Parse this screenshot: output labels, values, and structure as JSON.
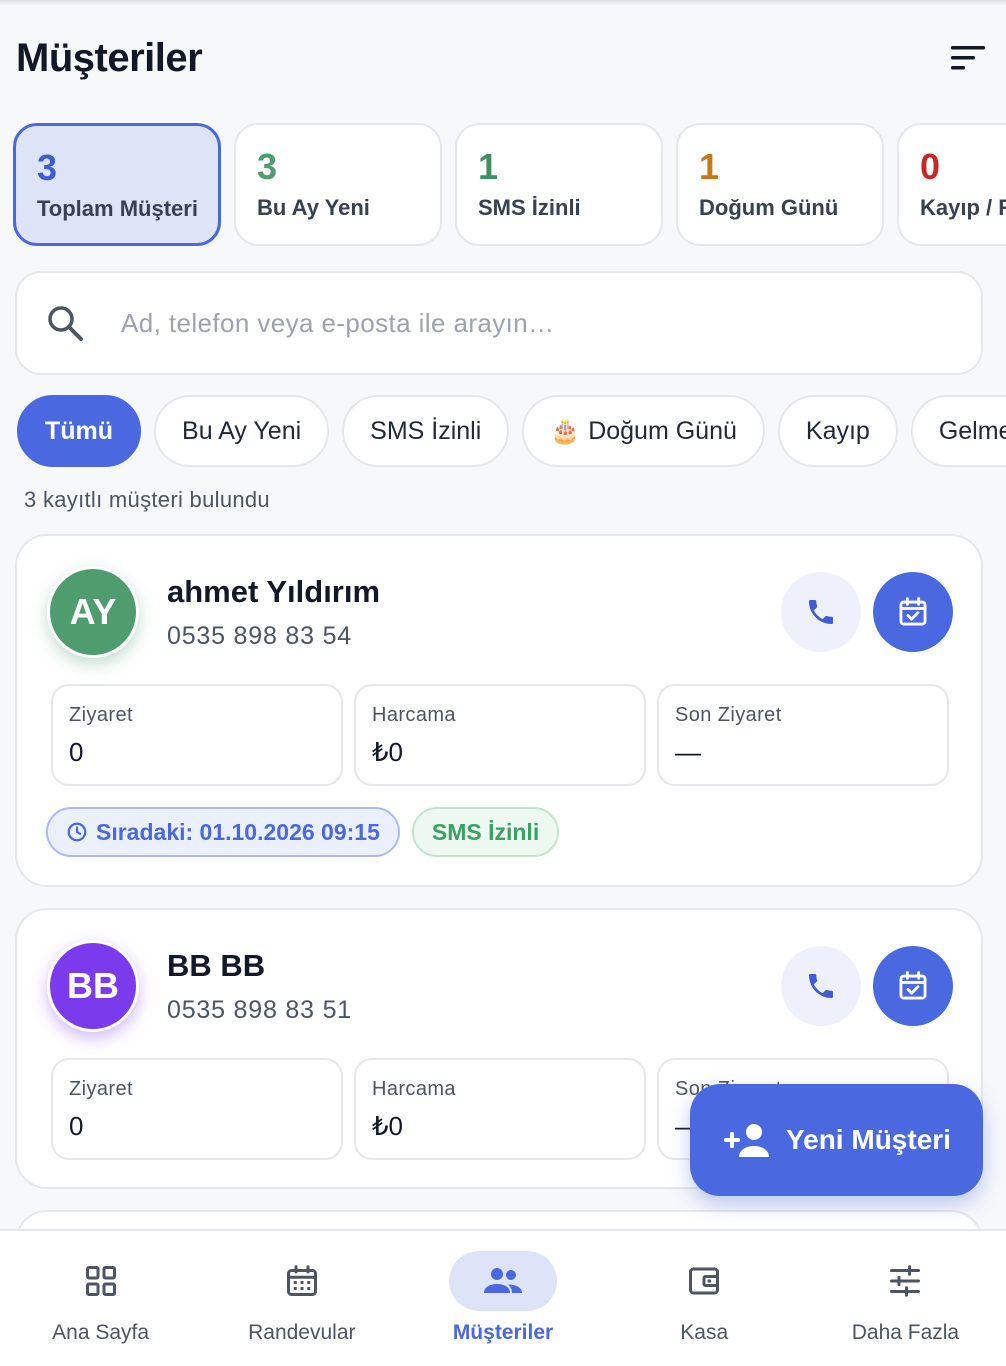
{
  "header": {
    "title": "Müşteriler",
    "sort_icon": "sort-lines-icon"
  },
  "stats": [
    {
      "value": "3",
      "label": "Toplam Müşteri",
      "color": "#3f5bd6",
      "active": true
    },
    {
      "value": "3",
      "label": "Bu Ay Yeni",
      "color": "#4f9d6f",
      "active": false
    },
    {
      "value": "1",
      "label": "SMS İzinli",
      "color": "#3e8f64",
      "active": false
    },
    {
      "value": "1",
      "label": "Doğum Günü",
      "color": "#c4781a",
      "active": false
    },
    {
      "value": "0",
      "label": "Kayıp / R",
      "color": "#c62828",
      "active": false
    }
  ],
  "search": {
    "placeholder": "Ad, telefon veya e-posta ile arayın…",
    "value": ""
  },
  "filters": [
    {
      "label": "Tümü",
      "active": true,
      "icon": ""
    },
    {
      "label": "Bu Ay Yeni",
      "active": false,
      "icon": ""
    },
    {
      "label": "SMS İzinli",
      "active": false,
      "icon": ""
    },
    {
      "label": "Doğum Günü",
      "active": false,
      "icon": "🎂"
    },
    {
      "label": "Kayıp",
      "active": false,
      "icon": ""
    },
    {
      "label": "Gelmem",
      "active": false,
      "icon": ""
    }
  ],
  "result_count": "3 kayıtlı müşteri bulundu",
  "metric_labels": {
    "visits": "Ziyaret",
    "spend": "Harcama",
    "last": "Son Ziyaret"
  },
  "customers": [
    {
      "initials": "AY",
      "name": "ahmet Yıldırım",
      "phone": "0535 898 83 54",
      "avatar_color": "#4f9d6f",
      "visits": "0",
      "spend": "₺0",
      "last_visit": "—",
      "next_badge": "Sıradaki: 01.10.2026 09:15",
      "sms_badge": "SMS İzinli"
    },
    {
      "initials": "BB",
      "name": "BB BB",
      "phone": "0535 898 83 51",
      "avatar_color": "#7c3aed",
      "visits": "0",
      "spend": "₺0",
      "last_visit": "—"
    }
  ],
  "fab": {
    "label": "Yeni Müşteri"
  },
  "nav": [
    {
      "label": "Ana Sayfa",
      "icon": "grid-icon",
      "active": false
    },
    {
      "label": "Randevular",
      "icon": "calendar-icon",
      "active": false
    },
    {
      "label": "Müşteriler",
      "icon": "people-icon",
      "active": true
    },
    {
      "label": "Kasa",
      "icon": "wallet-icon",
      "active": false
    },
    {
      "label": "Daha Fazla",
      "icon": "sliders-icon",
      "active": false
    }
  ],
  "colors": {
    "primary": "#4a69e0",
    "primary_soft": "#dde4f8",
    "border": "#e5e7eb"
  }
}
